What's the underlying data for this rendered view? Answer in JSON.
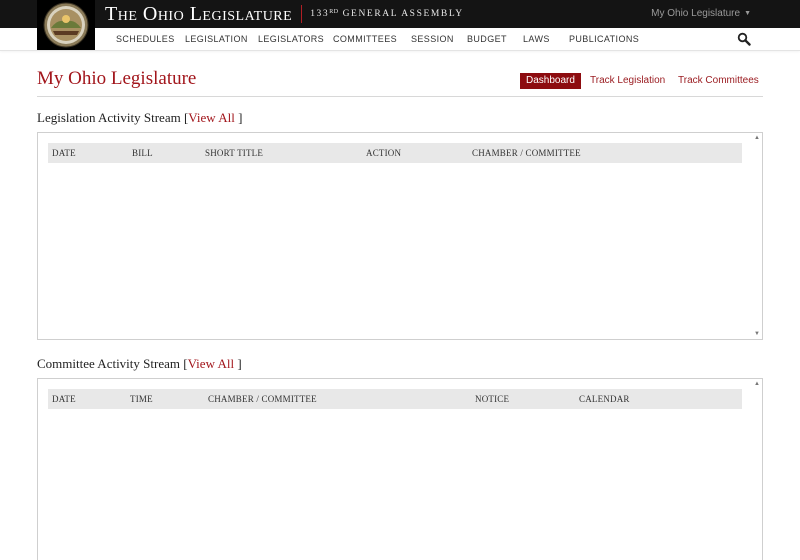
{
  "header": {
    "brand_title": "The Ohio Legislature",
    "assembly_prefix": "133",
    "assembly_sup": "RD",
    "assembly_suffix": "GENERAL ASSEMBLY",
    "account_label": "My Ohio Legislature"
  },
  "nav": {
    "items": [
      "SCHEDULES",
      "LEGISLATION",
      "LEGISLATORS",
      "COMMITTEES",
      "SESSION",
      "BUDGET",
      "LAWS",
      "PUBLICATIONS"
    ]
  },
  "page": {
    "title": "My Ohio Legislature",
    "tabs": [
      "Dashboard",
      "Track Legislation",
      "Track Committees"
    ],
    "active_tab": "Dashboard"
  },
  "legislation_stream": {
    "title": "Legislation Activity Stream",
    "bracket_open": "[",
    "view_all": "View All",
    "bracket_close": "]",
    "columns": [
      "DATE",
      "BILL",
      "SHORT TITLE",
      "ACTION",
      "CHAMBER / COMMITTEE"
    ]
  },
  "committee_stream": {
    "title": "Committee Activity Stream",
    "bracket_open": "[",
    "view_all": "View All",
    "bracket_close": "]",
    "columns": [
      "DATE",
      "TIME",
      "CHAMBER / COMMITTEE",
      "NOTICE",
      "CALENDAR"
    ]
  },
  "icons": {
    "seal": "ohio-seal-icon",
    "search": "search-icon",
    "caret": "caret-down-icon",
    "scroll_up": "scroll-up-arrow",
    "scroll_down": "scroll-down-arrow"
  },
  "colors": {
    "brand_red": "#a2161c",
    "active_tab_bg": "#8d0c10",
    "topbar_bg": "#141414",
    "table_head_bg": "#e8e8e8"
  }
}
